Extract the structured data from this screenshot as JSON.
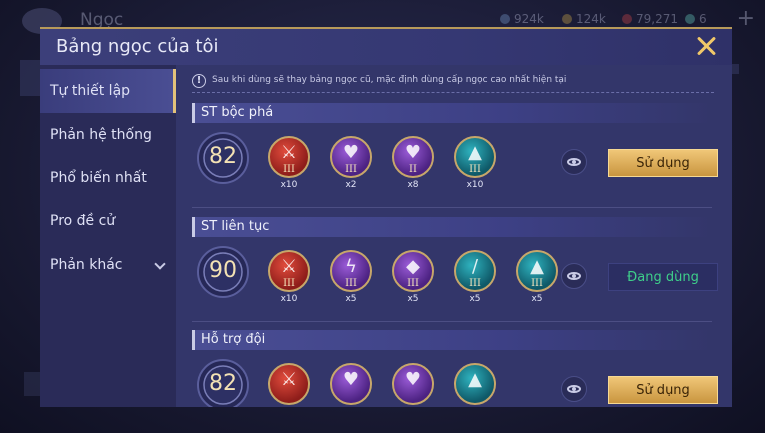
{
  "background": {
    "title": "Ngọc",
    "resources": [
      {
        "value": "924k",
        "color": "#7fa3d8"
      },
      {
        "value": "124k",
        "color": "#d8b04a"
      },
      {
        "value": "79,271",
        "color": "#d84a4a"
      },
      {
        "value": "6",
        "color": "#6ad8c8"
      }
    ],
    "plus": "+"
  },
  "dialog": {
    "title": "Bảng ngọc của tôi",
    "close_icon": "close-icon"
  },
  "sidebar": {
    "items": [
      {
        "label": "Tự thiết lập",
        "active": true
      },
      {
        "label": "Phản hệ thống"
      },
      {
        "label": "Phổ biến nhất"
      },
      {
        "label": "Pro đề cử"
      },
      {
        "label": "Phản khác",
        "expandable": true
      }
    ]
  },
  "notice": {
    "icon": "!",
    "text": "Sau khi dùng sẽ thay bảng ngọc cũ, mặc định dùng cấp ngọc cao nhất hiện tại"
  },
  "sets": [
    {
      "name": "ST bộc phá",
      "level": "82",
      "gems": [
        {
          "color": "red",
          "icon": "sword-icon",
          "tier": "III",
          "count": "x10"
        },
        {
          "color": "purple",
          "icon": "heart-icon",
          "tier": "III",
          "count": "x2"
        },
        {
          "color": "purple",
          "icon": "heart-icon",
          "tier": "II",
          "count": "x8"
        },
        {
          "color": "teal",
          "icon": "wing-icon",
          "tier": "III",
          "count": "x10"
        }
      ],
      "action": "Sử dụng",
      "state": "available"
    },
    {
      "name": "ST liên tục",
      "level": "90",
      "gems": [
        {
          "color": "red",
          "icon": "sword-icon",
          "tier": "III",
          "count": "x10"
        },
        {
          "color": "purple",
          "icon": "lightning-icon",
          "tier": "III",
          "count": "x5"
        },
        {
          "color": "purple",
          "icon": "crystal-icon",
          "tier": "III",
          "count": "x5"
        },
        {
          "color": "teal",
          "icon": "blade-icon",
          "tier": "III",
          "count": "x5"
        },
        {
          "color": "teal",
          "icon": "wing-icon",
          "tier": "III",
          "count": "x5"
        }
      ],
      "action": "Đang dùng",
      "state": "in-use"
    },
    {
      "name": "Hỗ trợ đội",
      "level": "82",
      "gems": [
        {
          "color": "red",
          "icon": "sword-icon"
        },
        {
          "color": "purple",
          "icon": "heart-icon"
        },
        {
          "color": "purple",
          "icon": "heart-icon"
        },
        {
          "color": "teal",
          "icon": "wing-icon"
        }
      ],
      "action": "Sử dụng",
      "state": "available"
    }
  ]
}
